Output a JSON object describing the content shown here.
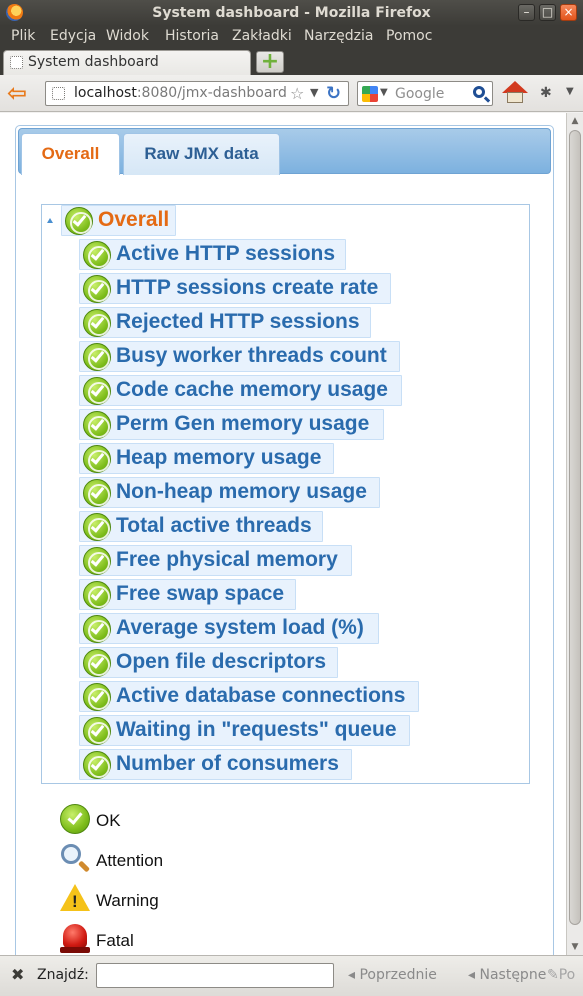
{
  "window": {
    "title": "System dashboard - Mozilla Firefox"
  },
  "menu": [
    "Plik",
    "Edycja",
    "Widok",
    "Historia",
    "Zakładki",
    "Narzędzia",
    "Pomoc"
  ],
  "tab": {
    "title": "System dashboard"
  },
  "address": {
    "host": "localhost",
    "rest": ":8080/jmx-dashboard/"
  },
  "search": {
    "placeholder": "Google"
  },
  "page_tabs": {
    "overall": "Overall",
    "raw": "Raw JMX data"
  },
  "tree": {
    "root": "Overall",
    "items": [
      "Active HTTP sessions",
      "HTTP sessions create rate",
      "Rejected HTTP sessions",
      "Busy worker threads count",
      "Code cache memory usage",
      "Perm Gen memory usage",
      "Heap memory usage",
      "Non-heap memory usage",
      "Total active threads",
      "Free physical memory",
      "Free swap space",
      "Average system load (%)",
      "Open file descriptors",
      "Active database connections",
      "Waiting in \"requests\" queue",
      "Number of consumers"
    ]
  },
  "legend": {
    "ok": "OK",
    "attention": "Attention",
    "warning": "Warning",
    "fatal": "Fatal"
  },
  "findbar": {
    "label": "Znajdź:",
    "prev": "Poprzednie",
    "next": "Następne",
    "highlight": "Po"
  }
}
